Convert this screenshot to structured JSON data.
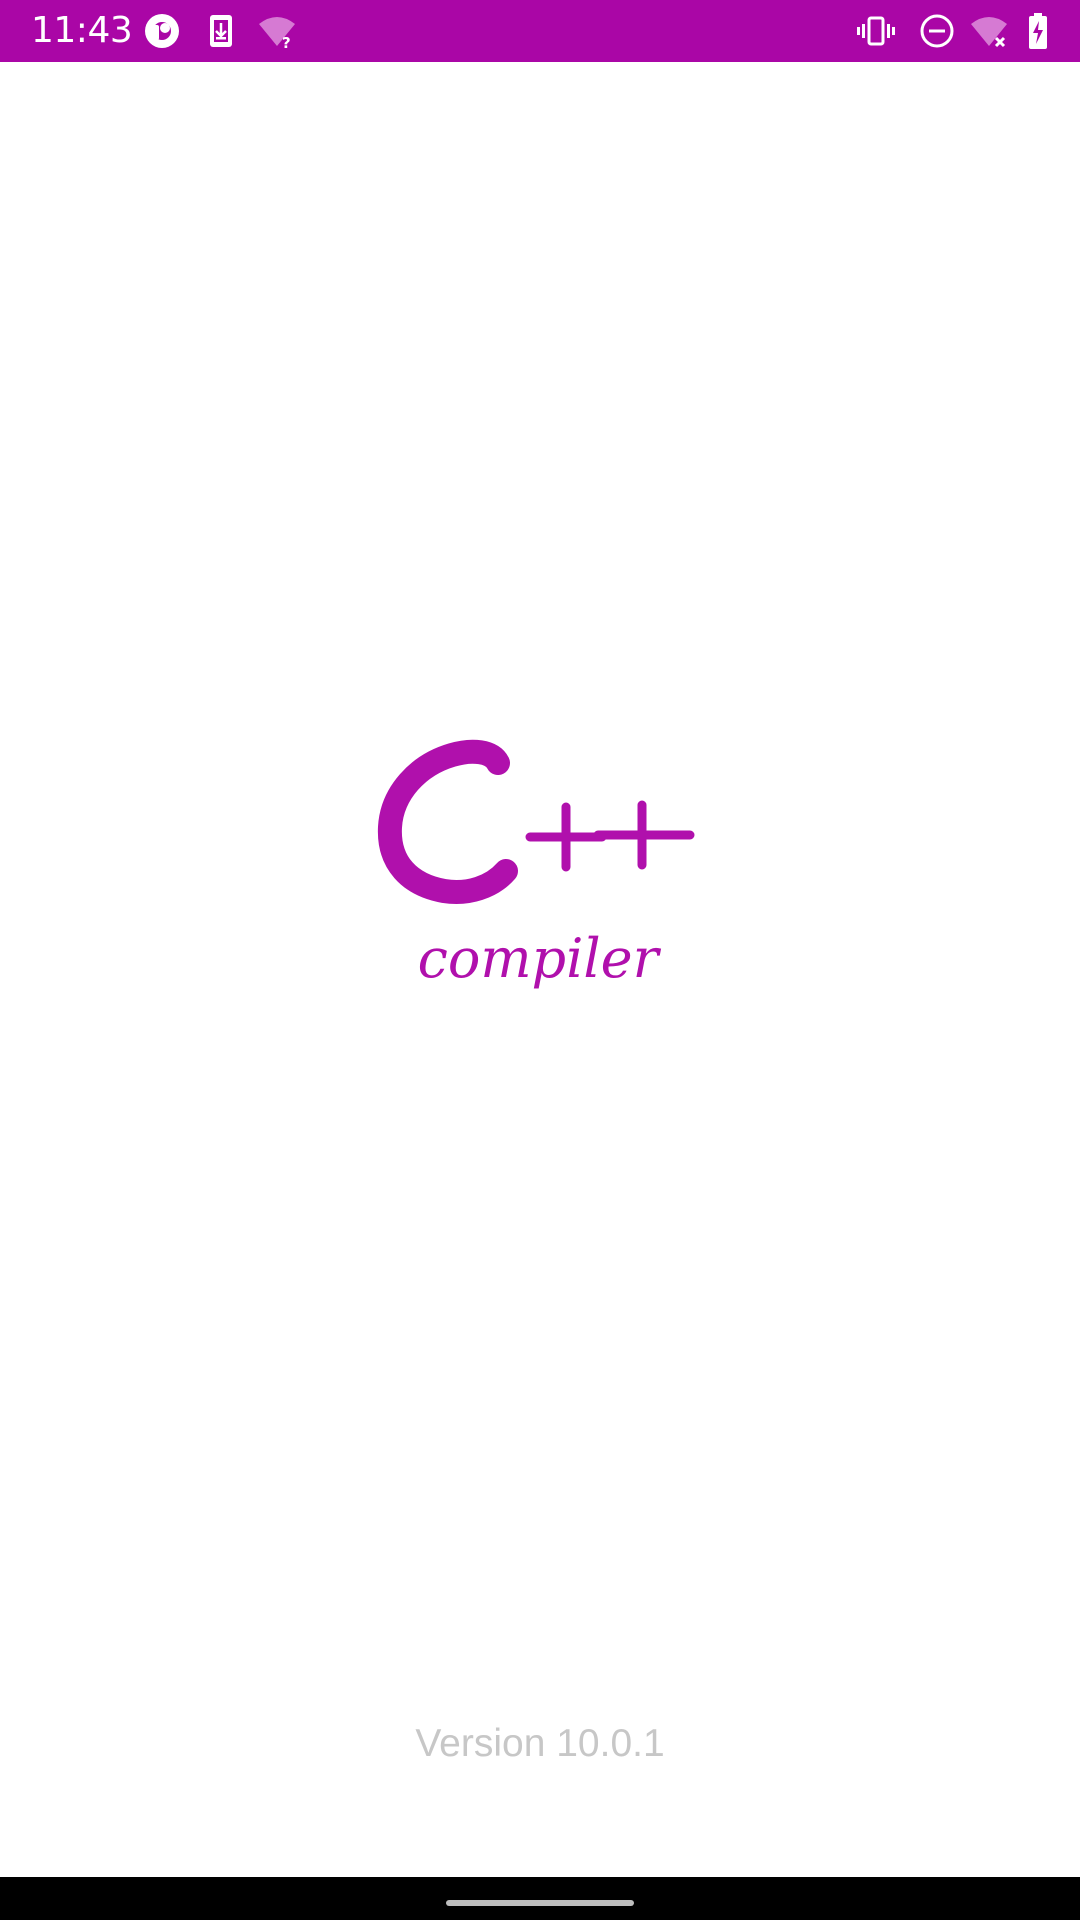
{
  "status_bar": {
    "time": "11:43",
    "background_color": "#aa06a6",
    "left_icons": [
      "pocket-casts-icon",
      "download-icon",
      "wifi-question-icon"
    ],
    "right_icons": [
      "vibrate-icon",
      "do-not-disturb-icon",
      "wifi-off-icon",
      "battery-charging-icon"
    ]
  },
  "splash": {
    "logo_title": "C++",
    "logo_subtitle": "compiler",
    "logo_color": "#b010ac",
    "version_text": "Version 10.0.1"
  },
  "nav_bar": {
    "handle": "home-gesture-handle"
  }
}
